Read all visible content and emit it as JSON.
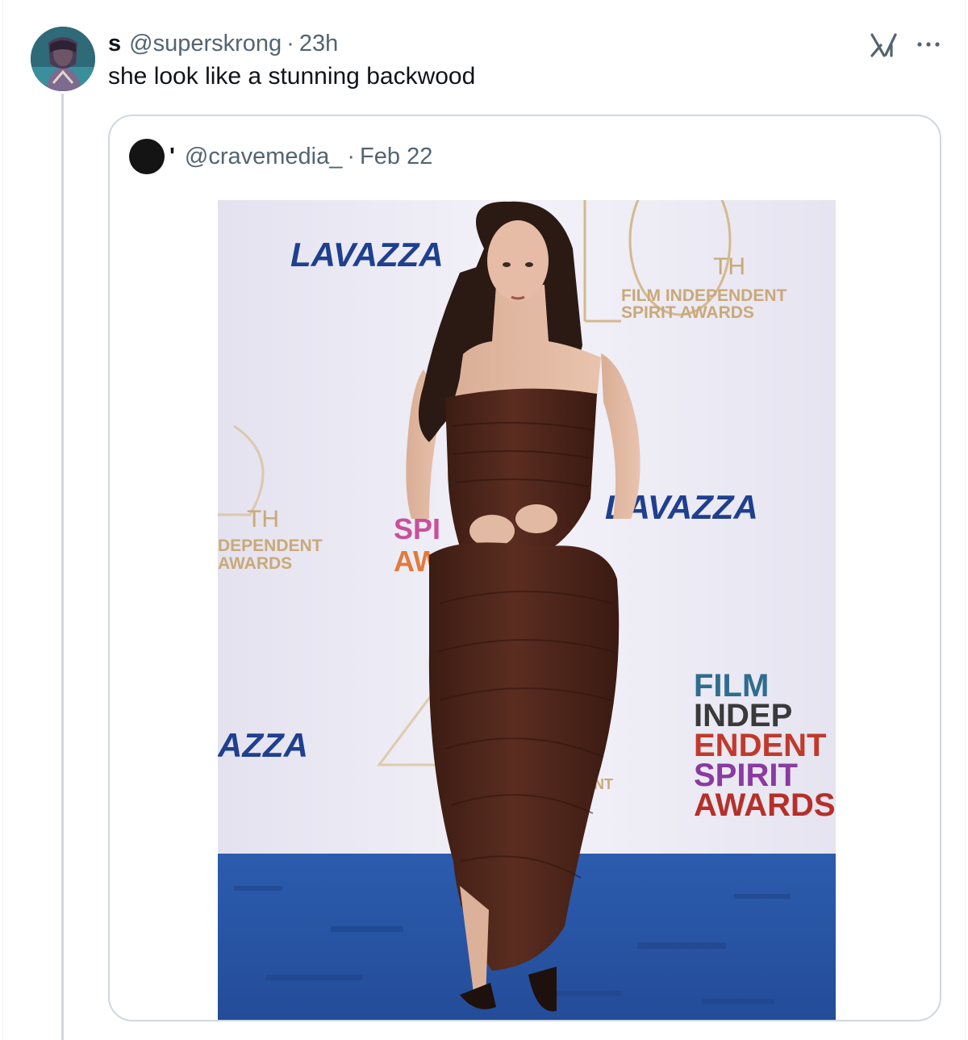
{
  "tweet": {
    "author_name": "s",
    "author_handle": "@superskrong",
    "separator": "·",
    "time": "23h",
    "text": "she look like a stunning backwood"
  },
  "icons": {
    "grok": "grok-icon",
    "more": "more-icon"
  },
  "quoted_tweet": {
    "author_name": "'",
    "author_handle": "@cravemedia_",
    "separator": "·",
    "date": "Feb 22",
    "photo": {
      "description_icon": "photo",
      "backdrop_texts": {
        "sponsor": "LAVAZZA",
        "sponsor_2": "LAVAZZA",
        "sponsor_3": "AZZA",
        "anniversary": "TH",
        "anniversary_2": "TH",
        "event_1": "FILM INDEPENDENT",
        "event_2": "SPIRIT AWARDS",
        "event_left_1": "DEPENDENT",
        "event_left_2": "AWARDS",
        "logo_lines": [
          "FILM",
          "INDEP",
          "ENDENT",
          "SPIRIT",
          "AWARDS"
        ],
        "logo_partial": [
          "SPI",
          "AW"
        ],
        "fragment_nt": "NT"
      }
    }
  },
  "colors": {
    "text_primary": "#0f1419",
    "text_secondary": "#536471",
    "border": "#cfd9de",
    "carpet": "#2f5aa8",
    "dress": "#4a2419",
    "lavazza_blue": "#1f3f8f"
  }
}
